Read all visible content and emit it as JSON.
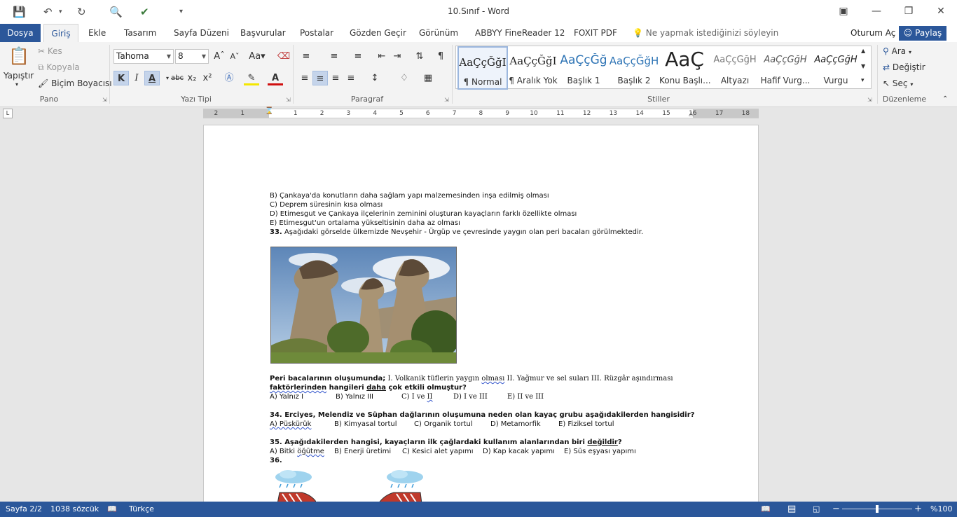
{
  "window": {
    "title": "10.Sınıf - Word"
  },
  "tabs": {
    "file": "Dosya",
    "items": [
      "Giriş",
      "Ekle",
      "Tasarım",
      "Sayfa Düzeni",
      "Başvurular",
      "Postalar",
      "Gözden Geçir",
      "Görünüm",
      "ABBYY FineReader 12",
      "FOXIT PDF"
    ],
    "tell_me": "Ne yapmak istediğinizi söyleyin",
    "sign_in": "Oturum Aç",
    "share": "Paylaş"
  },
  "ribbon": {
    "clipboard": {
      "paste": "Yapıştır",
      "cut": "Kes",
      "copy": "Kopyala",
      "format_painter": "Biçim Boyacısı",
      "label": "Pano"
    },
    "font": {
      "family": "Tahoma",
      "size": "8",
      "bold": "K",
      "italic": "I",
      "underline": "A",
      "strike": "abc",
      "sub": "x₂",
      "sup": "x²",
      "label": "Yazı Tipi"
    },
    "paragraph_label": "Paragraf",
    "styles": {
      "label": "Stiller",
      "items": [
        {
          "preview": "AaÇçĞğI",
          "name": "¶ Normal"
        },
        {
          "preview": "AaÇçĞğI",
          "name": "¶ Aralık Yok"
        },
        {
          "preview": "AaÇçĞğ",
          "name": "Başlık 1"
        },
        {
          "preview": "AaÇçĞğH",
          "name": "Başlık 2"
        },
        {
          "preview": "AaÇ",
          "name": "Konu Başlı..."
        },
        {
          "preview": "AaÇçĞğH",
          "name": "Altyazı"
        },
        {
          "preview": "AaÇçĞğH",
          "name": "Hafif Vurg..."
        },
        {
          "preview": "AaÇçĞğH",
          "name": "Vurgu"
        }
      ]
    },
    "editing": {
      "find": "Ara",
      "replace": "Değiştir",
      "select": "Seç",
      "label": "Düzenleme"
    }
  },
  "ruler": {
    "ticks": [
      "2",
      "1",
      "1",
      "2",
      "3",
      "4",
      "5",
      "6",
      "7",
      "8",
      "9",
      "10",
      "11",
      "12",
      "13",
      "14",
      "15",
      "16",
      "17",
      "18"
    ]
  },
  "document": {
    "line1": "B) Çankaya'da konutların daha sağlam yapı malzemesinden inşa edilmiş olması",
    "line2": "C) Deprem süresinin kısa olması",
    "line3": "D) Etimesgut ve Çankaya ilçelerinin zeminini oluşturan kayaçların farklı özellikte olması",
    "line4": "E) Etimesgut'un ortalama yükseltisinin daha az olması",
    "q33_num": "33.",
    "q33_text": " Aşağıdaki görselde ülkemizde Nevşehir - Ürgüp ve çevresinde yaygın olan peri bacaları görülmektedir.",
    "peri_bold": "Peri bacalarının oluşumunda;",
    "peri_rest_a": " I. Volkanik tüflerin yaygın ",
    "peri_olmasi": "olması",
    "peri_rest_b": "   II. Yağmur ve sel suları    III. Rüzgâr aşındırması",
    "fact_a": "faktörlerinden",
    "fact_b": " hangileri ",
    "fact_c": "daha",
    "fact_d": " çok etkili olmuştur?",
    "q33_a": "A) Yalnız I",
    "q33_b": "B) Yalnız III",
    "q33_c_a": "C) I ve ",
    "q33_c_b": "II",
    "q33_d": "D) I ve III",
    "q33_e": "E) II ve III",
    "q34": "34. Erciyes, Melendiz ve Süphan dağlarının oluşumuna neden olan kayaç grubu aşağıdakilerden hangisidir?",
    "q34_a": "A) Püskürük",
    "q34_b": "B) Kimyasal tortul",
    "q34_c": "C) Organik tortul",
    "q34_d": "D) Metamorfik",
    "q34_e": "E) Fiziksel tortul",
    "q35_a": "35. Aşağıdakilerden hangisi, kayaçların ilk çağlardaki kullanım alanlarından biri ",
    "q35_neg": "değildir",
    "q35_q": "?",
    "q35_oa": "A) Bitki ",
    "q35_oa2": "öğütme",
    "q35_ob": "B) Enerji üretimi",
    "q35_oc": "C) Kesici alet yapımı",
    "q35_od": "D) Kap kacak yapımı",
    "q35_oe": "E) Süs eşyası yapımı",
    "q36": "36."
  },
  "status": {
    "page": "Sayfa 2/2",
    "words": "1038 sözcük",
    "language": "Türkçe",
    "zoom": "%100"
  },
  "colors": {
    "accent": "#2b579a"
  }
}
